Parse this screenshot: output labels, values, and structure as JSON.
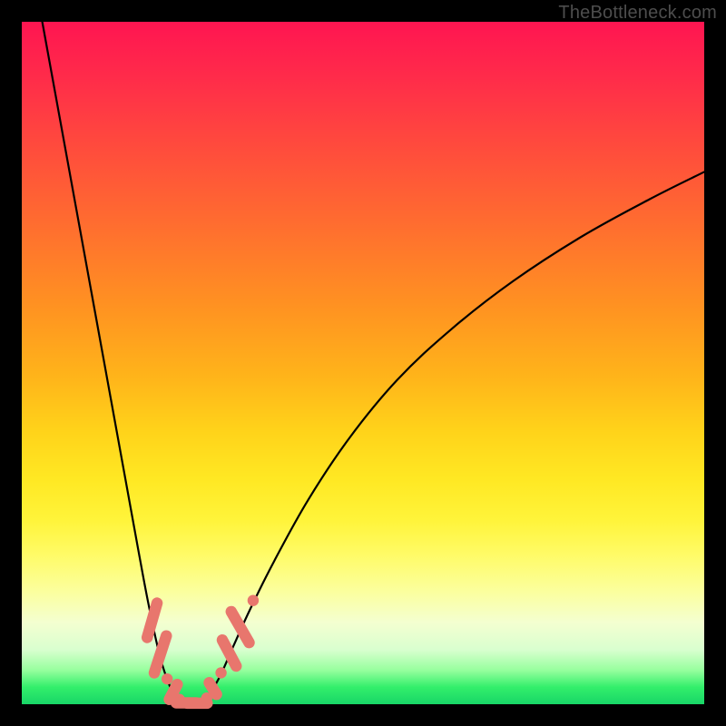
{
  "watermark": "TheBottleneck.com",
  "chart_data": {
    "type": "line",
    "title": "",
    "xlabel": "",
    "ylabel": "",
    "xlim": [
      0,
      100
    ],
    "ylim": [
      0,
      100
    ],
    "grid": false,
    "series": [
      {
        "name": "left-branch",
        "x": [
          3,
          5,
          7,
          9,
          11,
          13,
          15,
          17,
          18.5,
          20,
          21,
          22,
          23,
          23.8
        ],
        "y": [
          100,
          89,
          78,
          67,
          56,
          45,
          34,
          23,
          15,
          8,
          4.5,
          2,
          0.8,
          0.2
        ]
      },
      {
        "name": "bottom-flat",
        "x": [
          23.8,
          25,
          26.3
        ],
        "y": [
          0.2,
          0.05,
          0.2
        ]
      },
      {
        "name": "right-branch",
        "x": [
          26.3,
          27.5,
          29,
          31,
          33.5,
          37,
          42,
          48,
          55,
          63,
          72,
          82,
          92,
          100
        ],
        "y": [
          0.2,
          1.5,
          4,
          8.5,
          14,
          21,
          30,
          39,
          47.5,
          55,
          62,
          68.5,
          74,
          78
        ]
      }
    ],
    "markers": {
      "name": "beads",
      "points": [
        {
          "x": 19.1,
          "y": 12.3,
          "shape": "capsule",
          "angle": -74,
          "len": 3.0
        },
        {
          "x": 20.3,
          "y": 7.3,
          "shape": "capsule",
          "angle": -72,
          "len": 3.2
        },
        {
          "x": 21.3,
          "y": 3.7,
          "shape": "round"
        },
        {
          "x": 22.2,
          "y": 1.8,
          "shape": "capsule",
          "angle": -62,
          "len": 1.8
        },
        {
          "x": 23.1,
          "y": 0.7,
          "shape": "round"
        },
        {
          "x": 24.1,
          "y": 0.2,
          "shape": "capsule",
          "angle": 0,
          "len": 2.0
        },
        {
          "x": 25.7,
          "y": 0.15,
          "shape": "capsule",
          "angle": 0,
          "len": 2.0
        },
        {
          "x": 27.1,
          "y": 0.9,
          "shape": "round"
        },
        {
          "x": 28.0,
          "y": 2.3,
          "shape": "capsule",
          "angle": 58,
          "len": 1.6
        },
        {
          "x": 29.2,
          "y": 4.6,
          "shape": "round"
        },
        {
          "x": 30.4,
          "y": 7.5,
          "shape": "capsule",
          "angle": 62,
          "len": 2.6
        },
        {
          "x": 32.0,
          "y": 11.3,
          "shape": "capsule",
          "angle": 60,
          "len": 3.0
        },
        {
          "x": 33.9,
          "y": 15.2,
          "shape": "round"
        }
      ]
    },
    "background_gradient": {
      "direction": "top-to-bottom",
      "stops": [
        {
          "pos": 0.0,
          "color": "#ff1551"
        },
        {
          "pos": 0.3,
          "color": "#ff6e2f"
        },
        {
          "pos": 0.6,
          "color": "#ffd31a"
        },
        {
          "pos": 0.83,
          "color": "#fbff9e"
        },
        {
          "pos": 1.0,
          "color": "#18d667"
        }
      ]
    }
  }
}
